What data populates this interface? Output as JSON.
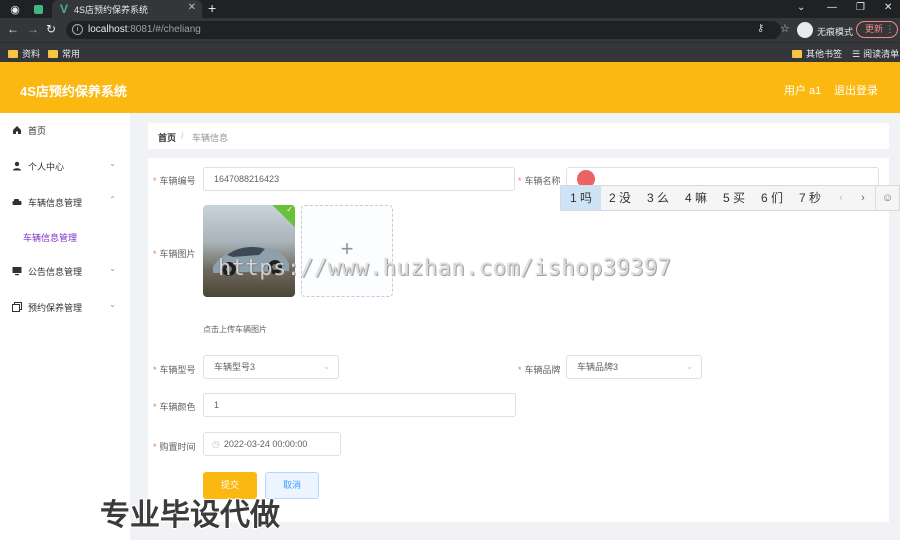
{
  "browser": {
    "tab_title": "4S店预约保养系统",
    "url_host": "localhost",
    "url_rest": ":8081/#/cheliang",
    "incognito_label": "无痕模式",
    "update_label": "更新",
    "bookmarks": [
      "资料",
      "常用"
    ],
    "bookmarks_right": [
      "其他书签",
      "阅读清单"
    ]
  },
  "header": {
    "title": "4S店预约保养系统",
    "user": "用户 a1",
    "logout": "退出登录"
  },
  "sidebar": {
    "items": [
      {
        "label": "首页",
        "icon": "home-icon"
      },
      {
        "label": "个人中心",
        "icon": "user-icon"
      },
      {
        "label": "车辆信息管理",
        "icon": "car-icon"
      },
      {
        "label": "公告信息管理",
        "icon": "monitor-icon"
      },
      {
        "label": "预约保养管理",
        "icon": "copy-icon"
      }
    ],
    "sub_active": "车辆信息管理"
  },
  "breadcrumb": {
    "home": "首页",
    "separator": "/",
    "current": "车辆信息"
  },
  "form": {
    "vehicle_no_label": "车辆编号",
    "vehicle_no_value": "1647088216423",
    "vehicle_name_label": "车辆名称",
    "vehicle_name_value": "",
    "image_label": "车辆图片",
    "upload_tip": "点击上传车辆图片",
    "model_label": "车辆型号",
    "model_value": "车辆型号3",
    "brand_label": "车辆品牌",
    "brand_value": "车辆品牌3",
    "color_label": "车辆颜色",
    "color_value": "1",
    "purchase_label": "购置时间",
    "purchase_value": "2022-03-24 00:00:00",
    "submit": "提交",
    "cancel": "取消"
  },
  "ime": {
    "candidates": [
      "1 吗",
      "2 没",
      "3 么",
      "4 嘛",
      "5 买",
      "6 们",
      "7 秒"
    ],
    "prev": "‹",
    "next": "›",
    "emoji": "☺"
  },
  "overlays": {
    "watermark": "https://www.huzhan.com/ishop39397",
    "promo": "专业毕设代做"
  },
  "colors": {
    "accent": "#fbb810",
    "submenu_active": "#7d30c6",
    "required": "#f56c6c",
    "success": "#67c23a"
  }
}
